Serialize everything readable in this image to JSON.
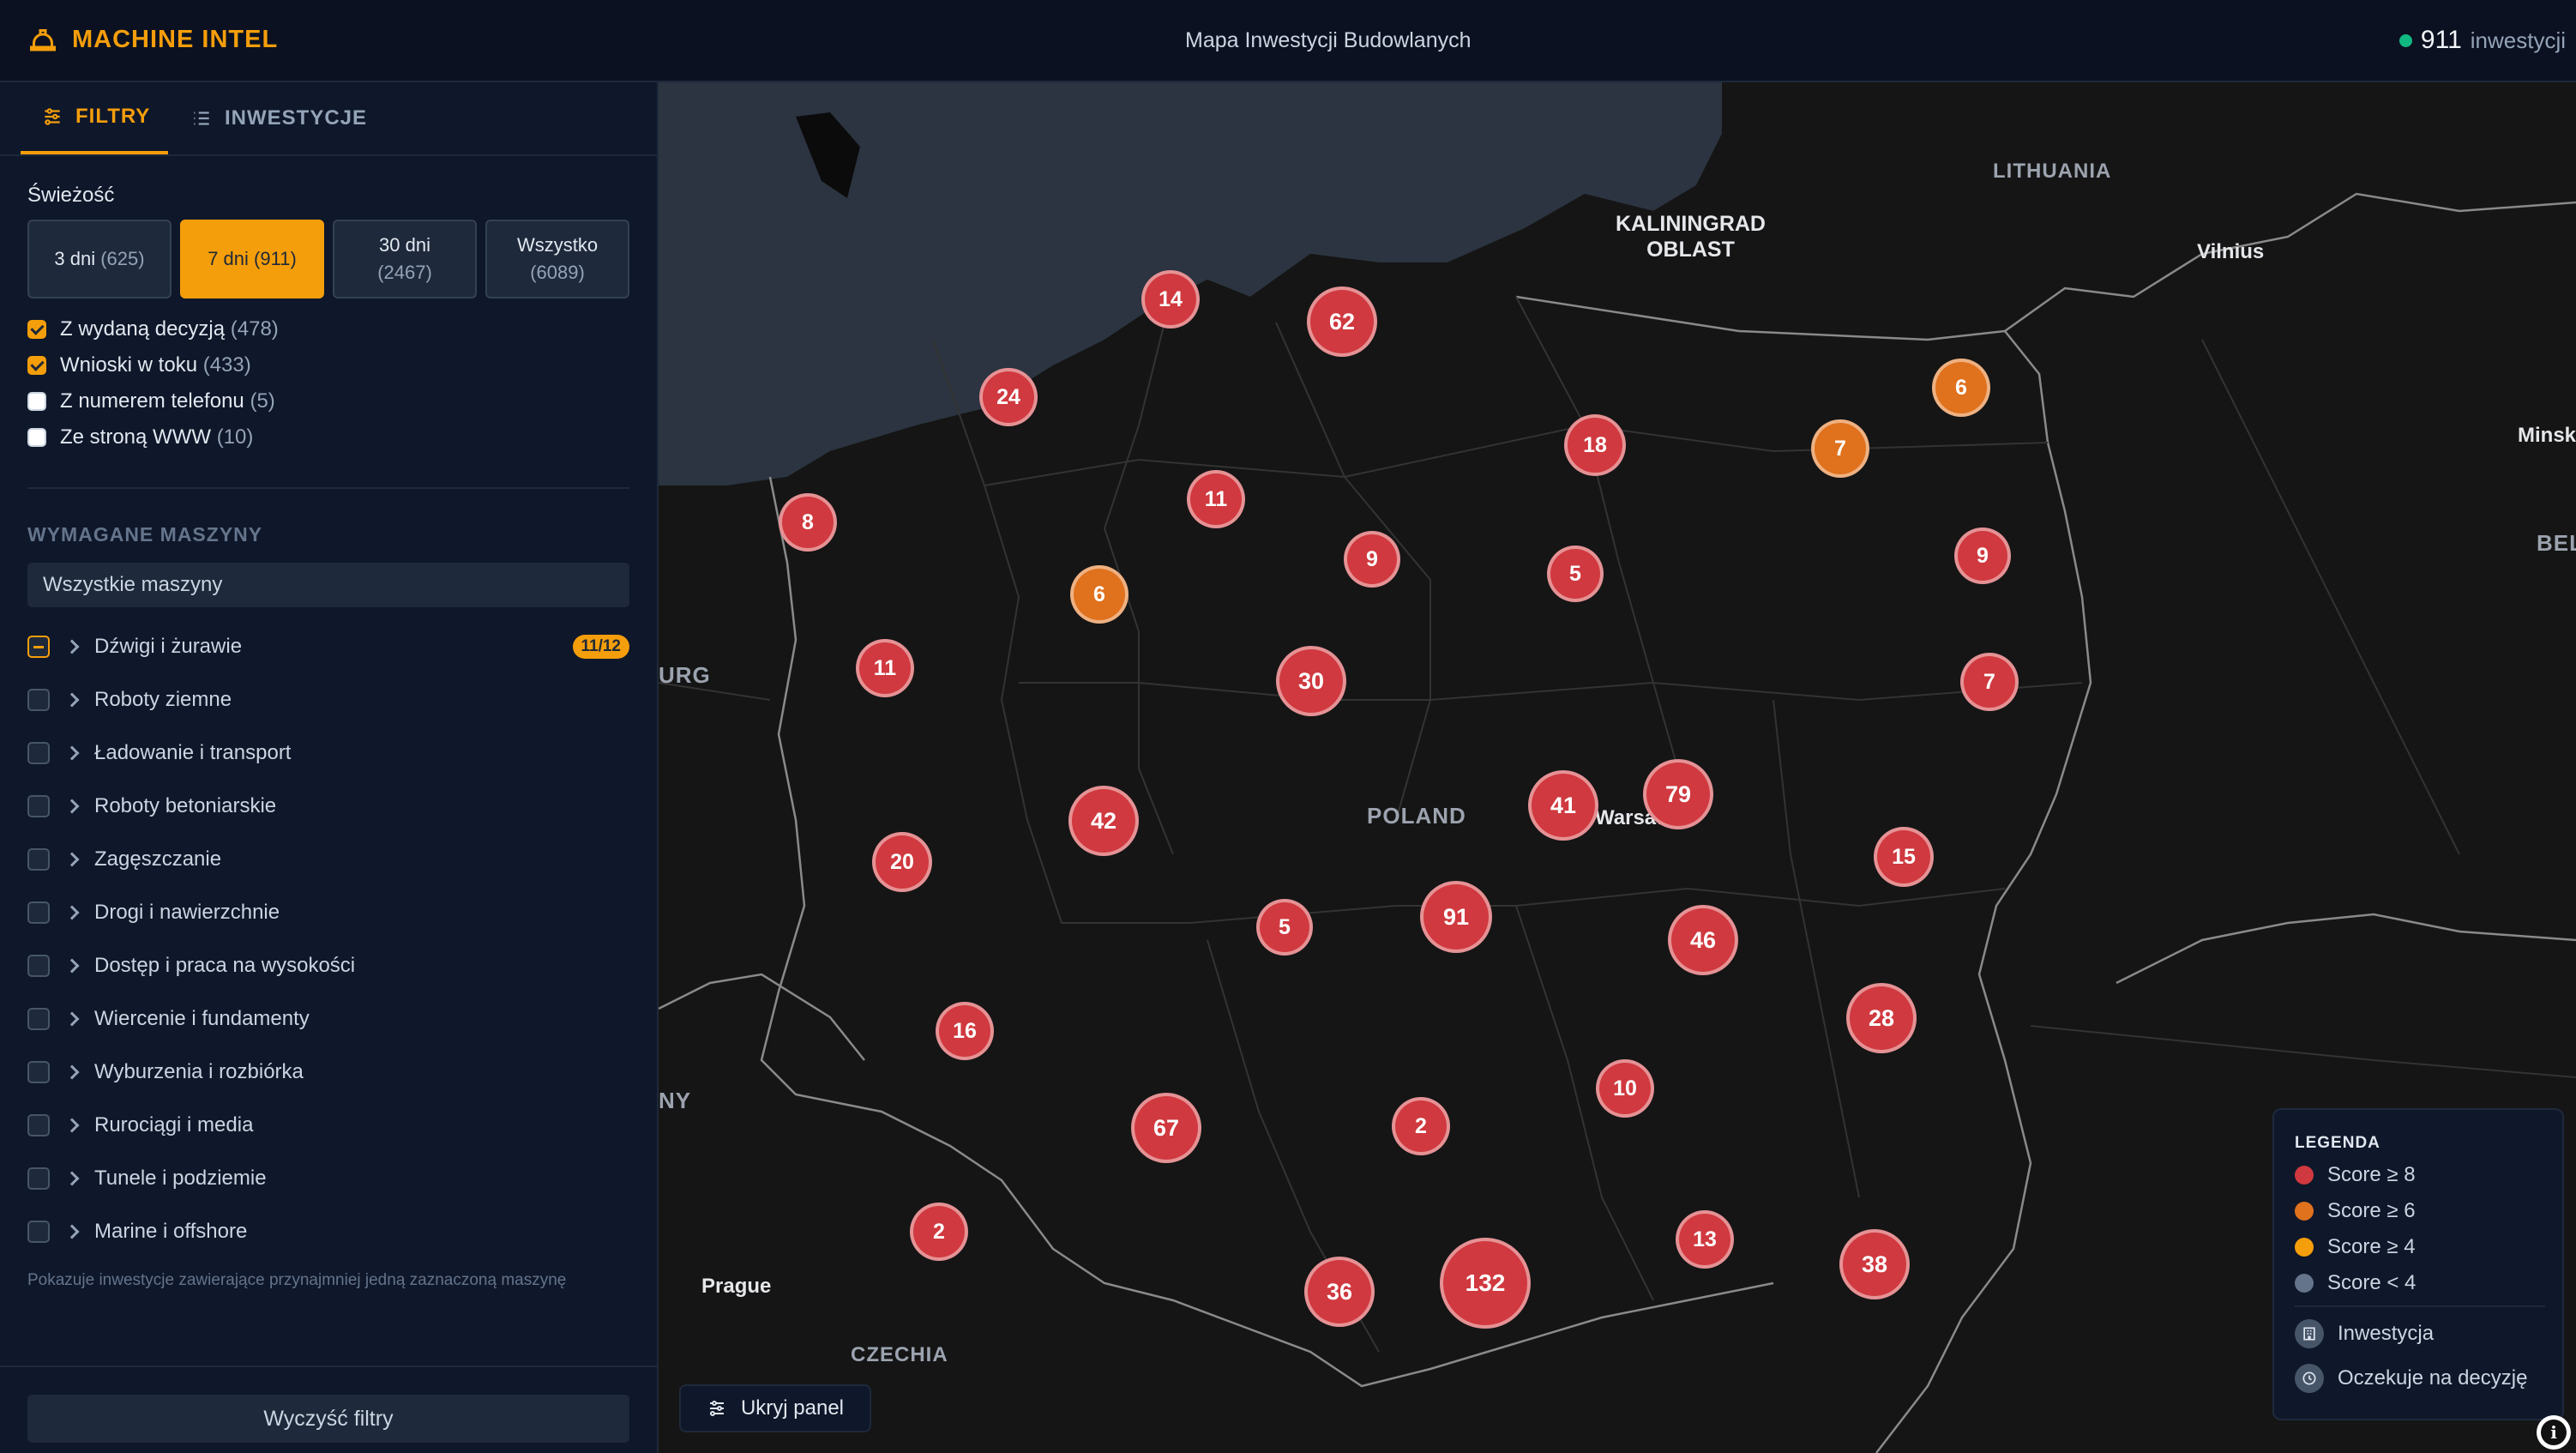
{
  "header": {
    "brand": "MACHINE INTEL",
    "title": "Mapa Inwestycji Budowlanych",
    "count": "911",
    "count_label": "inwestycji",
    "status_color": "#10b981"
  },
  "sidebar": {
    "tabs": [
      {
        "label": "FILTRY",
        "icon": "sliders-icon",
        "active": true
      },
      {
        "label": "INWESTYCJE",
        "icon": "list-icon",
        "active": false
      }
    ],
    "freshness_label": "Świeżość",
    "freshness": [
      {
        "label": "3 dni",
        "count": "(625)",
        "active": false
      },
      {
        "label": "7 dni",
        "count": "(911)",
        "active": true
      },
      {
        "label": "30 dni",
        "count": "(2467)",
        "active": false
      },
      {
        "label": "Wszystko",
        "count": "(6089)",
        "active": false
      }
    ],
    "checks": [
      {
        "label": "Z wydaną decyzją",
        "count": "(478)",
        "checked": true
      },
      {
        "label": "Wnioski w toku",
        "count": "(433)",
        "checked": true
      },
      {
        "label": "Z numerem telefonu",
        "count": "(5)",
        "checked": false
      },
      {
        "label": "Ze stroną WWW",
        "count": "(10)",
        "checked": false
      }
    ],
    "machines_label": "WYMAGANE MASZYNY",
    "machines_placeholder": "Wszystkie maszyny",
    "machines": [
      {
        "label": "Dźwigi i żurawie",
        "badge": "11/12",
        "state": "partial"
      },
      {
        "label": "Roboty ziemne",
        "state": "off"
      },
      {
        "label": "Ładowanie i transport",
        "state": "off"
      },
      {
        "label": "Roboty betoniarskie",
        "state": "off"
      },
      {
        "label": "Zagęszczanie",
        "state": "off"
      },
      {
        "label": "Drogi i nawierzchnie",
        "state": "off"
      },
      {
        "label": "Dostęp i praca na wysokości",
        "state": "off"
      },
      {
        "label": "Wiercenie i fundamenty",
        "state": "off"
      },
      {
        "label": "Wyburzenia i rozbiórka",
        "state": "off"
      },
      {
        "label": "Rurociągi i media",
        "state": "off"
      },
      {
        "label": "Tunele i podziemie",
        "state": "off"
      },
      {
        "label": "Marine i offshore",
        "state": "off"
      }
    ],
    "hint": "Pokazuje inwestycje zawierające przynajmniej jedną zaznaczoną maszynę",
    "clear_label": "Wyczyść filtry"
  },
  "map": {
    "labels": {
      "lithuania": "LITHUANIA",
      "kaliningrad_1": "KALININGRAD",
      "kaliningrad_2": "OBLAST",
      "vilnius": "Vilnius",
      "minsk": "Minsk",
      "belarus": "BEL",
      "poland": "POLAND",
      "warsaw": "Warsaw",
      "burg": "URG",
      "ny": "NY",
      "prague": "Prague",
      "czechia": "CZECHIA"
    },
    "clusters": [
      {
        "value": "14",
        "color": "red"
      },
      {
        "value": "62",
        "color": "red"
      },
      {
        "value": "24",
        "color": "red"
      },
      {
        "value": "6",
        "color": "orange"
      },
      {
        "value": "7",
        "color": "orange"
      },
      {
        "value": "18",
        "color": "red"
      },
      {
        "value": "11",
        "color": "red"
      },
      {
        "value": "8",
        "color": "red"
      },
      {
        "value": "9",
        "color": "red"
      },
      {
        "value": "5",
        "color": "red"
      },
      {
        "value": "9",
        "color": "red"
      },
      {
        "value": "6",
        "color": "orange"
      },
      {
        "value": "11",
        "color": "red"
      },
      {
        "value": "30",
        "color": "red"
      },
      {
        "value": "7",
        "color": "red"
      },
      {
        "value": "42",
        "color": "red"
      },
      {
        "value": "41",
        "color": "red"
      },
      {
        "value": "79",
        "color": "red"
      },
      {
        "value": "20",
        "color": "red"
      },
      {
        "value": "15",
        "color": "red"
      },
      {
        "value": "5",
        "color": "red"
      },
      {
        "value": "91",
        "color": "red"
      },
      {
        "value": "46",
        "color": "red"
      },
      {
        "value": "16",
        "color": "red"
      },
      {
        "value": "28",
        "color": "red"
      },
      {
        "value": "10",
        "color": "red"
      },
      {
        "value": "67",
        "color": "red"
      },
      {
        "value": "2",
        "color": "red"
      },
      {
        "value": "2",
        "color": "red"
      },
      {
        "value": "13",
        "color": "red"
      },
      {
        "value": "36",
        "color": "red"
      },
      {
        "value": "132",
        "color": "red"
      },
      {
        "value": "38",
        "color": "red"
      }
    ],
    "hide_panel_label": "Ukryj panel"
  },
  "legend": {
    "title": "LEGENDA",
    "scores": [
      {
        "label": "Score ≥ 8",
        "color": "#d0393f"
      },
      {
        "label": "Score ≥ 6",
        "color": "#e0711d"
      },
      {
        "label": "Score ≥ 4",
        "color": "#f59e0b"
      },
      {
        "label": "Score < 4",
        "color": "#64748b"
      }
    ],
    "items": [
      {
        "label": "Inwestycja",
        "icon": "building-icon"
      },
      {
        "label": "Oczekuje na decyzję",
        "icon": "clock-icon"
      }
    ]
  }
}
